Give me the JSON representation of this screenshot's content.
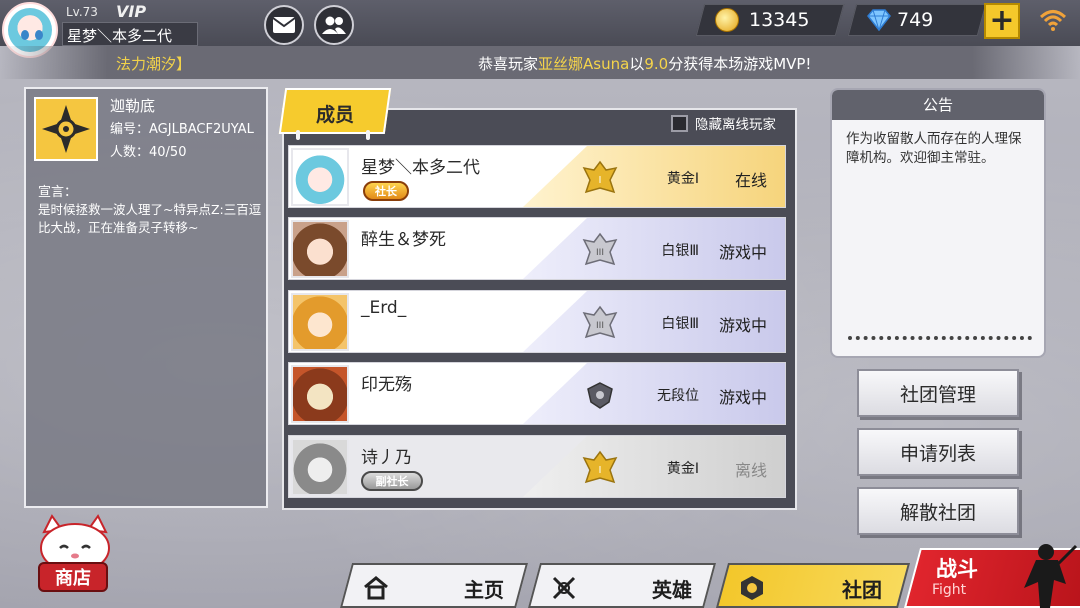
{
  "player": {
    "level": "Lv.73",
    "vip": "VIP",
    "name": "星梦＼本多二代"
  },
  "resources": {
    "gold": "13345",
    "diamonds": "749",
    "add_label": "+"
  },
  "marquee": {
    "left_text": "法力潮汐】",
    "prefix": "恭喜玩家",
    "player": "亚丝娜Asuna",
    "middle": "以",
    "score": "9.0",
    "suffix": "分获得本场游戏MVP!"
  },
  "guild": {
    "name": "迦勒底",
    "id_label": "编号：AGJLBACF2UYAL",
    "count_label": "人数：40/50",
    "declaration_title": "宣言：",
    "declaration": "是时候拯救一波人理了~特异点Z:三百逗比大战，正在准备灵子转移~"
  },
  "members_tab": {
    "label": "成员",
    "hide_offline_label": "隐藏离线玩家"
  },
  "members": [
    {
      "name": "星梦＼本多二代",
      "role": "社长",
      "rank": "黄金Ⅰ",
      "status": "在线",
      "tier": "gold"
    },
    {
      "name": "醉生＆梦死",
      "role": "",
      "rank": "白银Ⅲ",
      "status": "游戏中",
      "tier": "silver"
    },
    {
      "name": "_Erd_",
      "role": "",
      "rank": "白银Ⅲ",
      "status": "游戏中",
      "tier": "silver"
    },
    {
      "name": "印无殇",
      "role": "",
      "rank": "无段位",
      "status": "游戏中",
      "tier": "none"
    },
    {
      "name": "诗丿乃",
      "role": "副社长",
      "rank": "黄金Ⅰ",
      "status": "离线",
      "tier": "gold-off"
    }
  ],
  "notice": {
    "title": "公告",
    "body": "作为收留散人而存在的人理保障机构。欢迎御主常驻。"
  },
  "actions": {
    "manage": "社团管理",
    "requests": "申请列表",
    "disband": "解散社团"
  },
  "nav": {
    "shop": "商店",
    "home": "主页",
    "heroes": "英雄",
    "club": "社团",
    "fight_cn": "战斗",
    "fight_en": "Fight"
  },
  "colors": {
    "accent_yellow": "#f6cb2d",
    "fight_red": "#d81f27",
    "gold_tier": "#f6d47c",
    "silver_tier": "#c9c9eb"
  }
}
